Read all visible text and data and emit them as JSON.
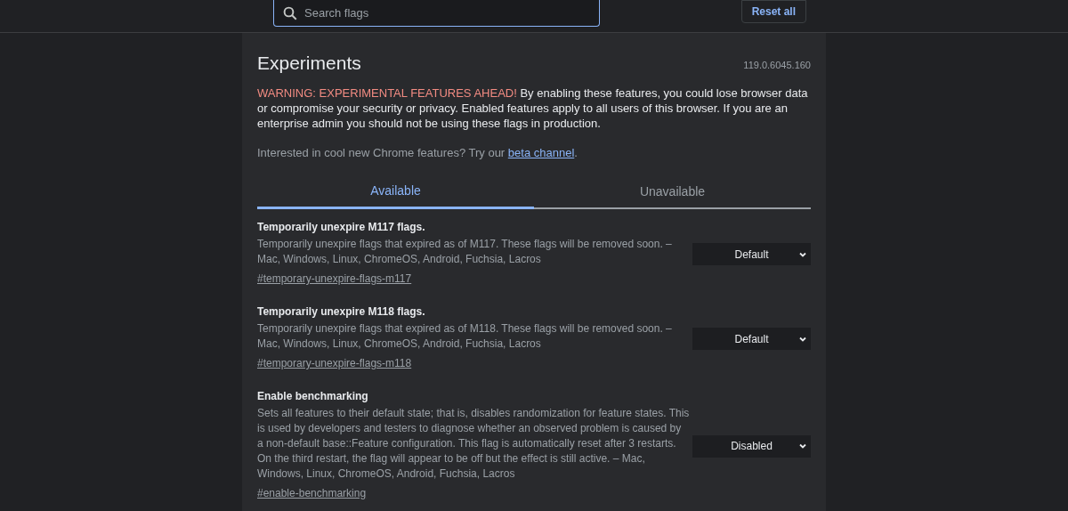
{
  "search": {
    "placeholder": "Search flags"
  },
  "reset_button": "Reset all",
  "title": "Experiments",
  "version": "119.0.6045.160",
  "warning": {
    "prefix": "WARNING: EXPERIMENTAL FEATURES AHEAD!",
    "text": " By enabling these features, you could lose browser data or compromise your security or privacy. Enabled features apply to all users of this browser. If you are an enterprise admin you should not be using these flags in production."
  },
  "beta_note": {
    "text": "Interested in cool new Chrome features? Try our ",
    "link": "beta channel",
    "end": "."
  },
  "tabs": [
    {
      "label": "Available",
      "selected": true
    },
    {
      "label": "Unavailable",
      "selected": false
    }
  ],
  "flags": [
    {
      "title": "Temporarily unexpire M117 flags.",
      "description": "Temporarily unexpire flags that expired as of M117. These flags will be removed soon. – Mac, Windows, Linux, ChromeOS, Android, Fuchsia, Lacros",
      "anchor": "#temporary-unexpire-flags-m117",
      "value": "Default"
    },
    {
      "title": "Temporarily unexpire M118 flags.",
      "description": "Temporarily unexpire flags that expired as of M118. These flags will be removed soon. – Mac, Windows, Linux, ChromeOS, Android, Fuchsia, Lacros",
      "anchor": "#temporary-unexpire-flags-m118",
      "value": "Default"
    },
    {
      "title": "Enable benchmarking",
      "description": "Sets all features to their default state; that is, disables randomization for feature states. This is used by developers and testers to diagnose whether an observed problem is caused by a non-default base::Feature configuration. This flag is automatically reset after 3 restarts. On the third restart, the flag will appear to be off but the effect is still active. – Mac, Windows, Linux, ChromeOS, Android, Fuchsia, Lacros",
      "anchor": "#enable-benchmarking",
      "value": "Disabled"
    }
  ]
}
